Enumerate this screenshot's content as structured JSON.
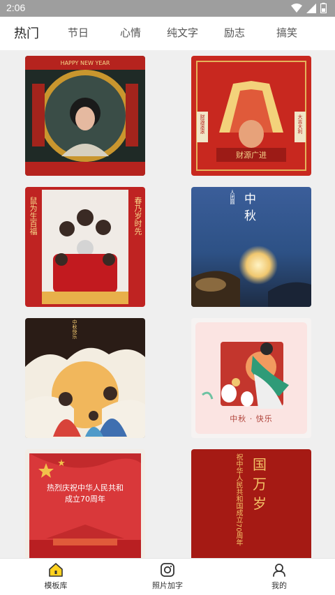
{
  "status_bar": {
    "time": "2:06"
  },
  "tabs": [
    {
      "label": "热门",
      "active": true
    },
    {
      "label": "节日"
    },
    {
      "label": "心情"
    },
    {
      "label": "纯文字"
    },
    {
      "label": "励志"
    },
    {
      "label": "搞笑"
    }
  ],
  "cards": {
    "c1": {
      "banner": "HAPPY NEW YEAR"
    },
    "c2": {
      "left_scroll": "财源滚滚",
      "right_scroll": "大吉大利",
      "banner": "财源广进"
    },
    "c3": {
      "left_couplet": "鼠为生百福",
      "right_couplet": "春乃岁时先"
    },
    "c4": {
      "title": "中秋",
      "subtitle": "人团圆"
    },
    "c5": {
      "corner_text": "中秋快乐"
    },
    "c6": {
      "caption": "中秋 · 快乐"
    },
    "c7": {
      "line1": "热烈庆祝中华人民共和",
      "line2": "成立70周年"
    },
    "c8": {
      "headline": "国万岁",
      "vertical_text": "祝中华人民共和国成立70周年"
    }
  },
  "bottom_nav": [
    {
      "label": "模板库",
      "icon": "home-icon",
      "active": true
    },
    {
      "label": "照片加字",
      "icon": "camera-icon"
    },
    {
      "label": "我的",
      "icon": "person-icon"
    }
  ]
}
